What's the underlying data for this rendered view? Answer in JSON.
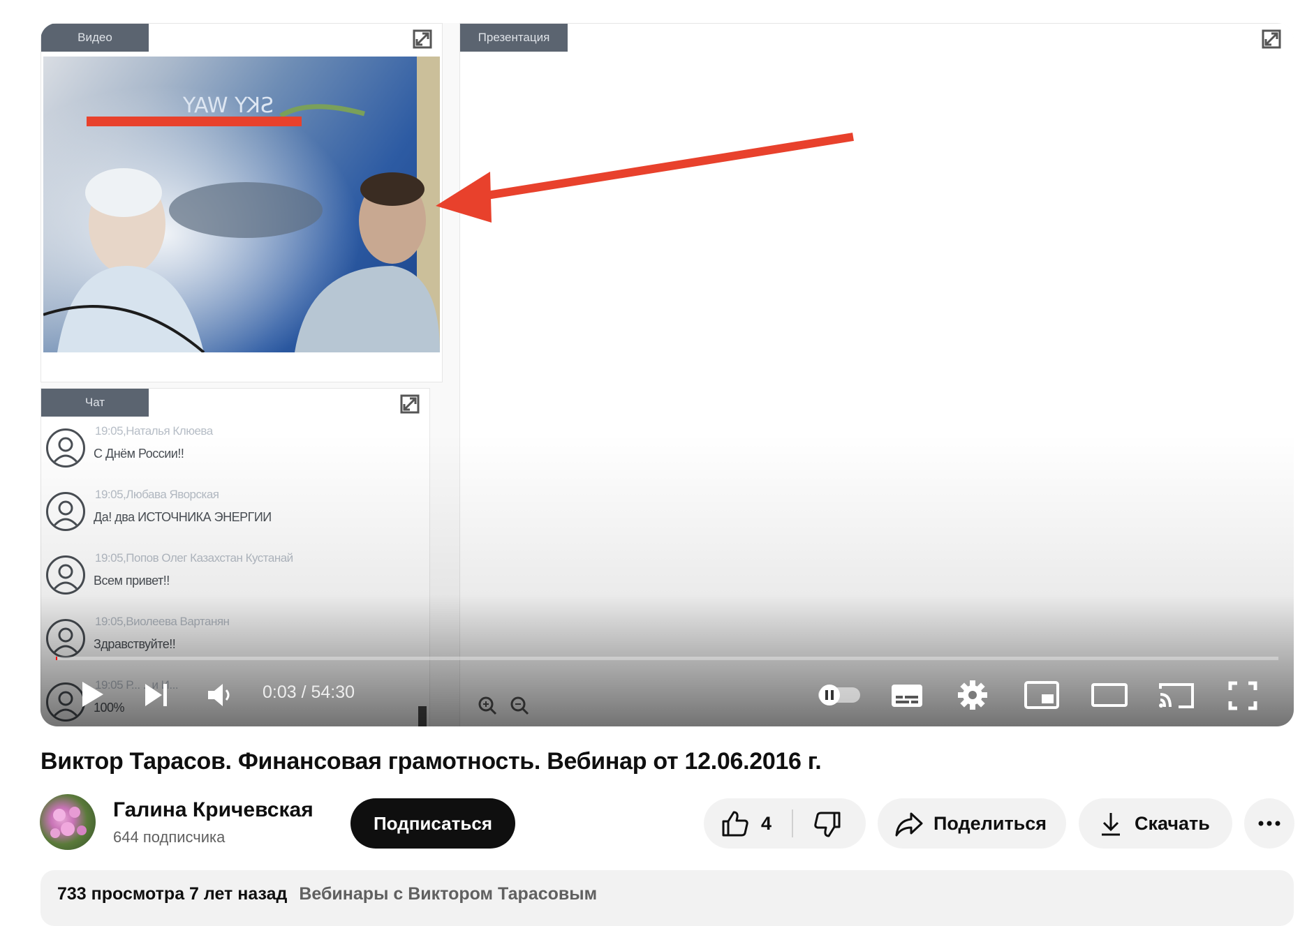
{
  "player": {
    "video_panel_label": "Видео",
    "chat_panel_label": "Чат",
    "presentation_panel_label": "Презентация",
    "chat_messages": [
      {
        "meta": "19:05,Наталья Клюева",
        "text": "С Днём России!!"
      },
      {
        "meta": "19:05,Любава Яворская",
        "text": "Да! два ИСТОЧНИКА ЭНЕРГИИ"
      },
      {
        "meta": "19:05,Попов Олег Казахстан Кустанай",
        "text": "Всем привет!!"
      },
      {
        "meta": "19:05,Виолеева Вартанян",
        "text": "Здравствуйте!!"
      },
      {
        "meta": "19:05 Р... ...и И...",
        "text": "100%"
      }
    ],
    "current_time": "0:03",
    "duration": "54:30",
    "time_display": "0:03 / 54:30",
    "progress_fraction": 0.001,
    "autoplay_toggle": "off",
    "accent_color": "#ff0000",
    "controls": [
      "play-icon",
      "next-icon",
      "volume-icon",
      "autoplay-toggle",
      "subtitles-icon",
      "settings-gear-icon",
      "miniplayer-icon",
      "theater-mode-icon",
      "cast-icon",
      "fullscreen-icon"
    ],
    "annotation_color": "#e8412c"
  },
  "video": {
    "title": "Виктор Тарасов. Финансовая грамотность. Вебинар от 12.06.2016 г."
  },
  "channel": {
    "name": "Галина Кричевская",
    "subscribers": "644 подписчика",
    "subscribe_label": "Подписаться"
  },
  "actions": {
    "like_count": "4",
    "share_label": "Поделиться",
    "download_label": "Скачать"
  },
  "description": {
    "views_and_age": "733 просмотра  7 лет назад",
    "playlist": "Вебинары с Виктором Тарасовым"
  }
}
